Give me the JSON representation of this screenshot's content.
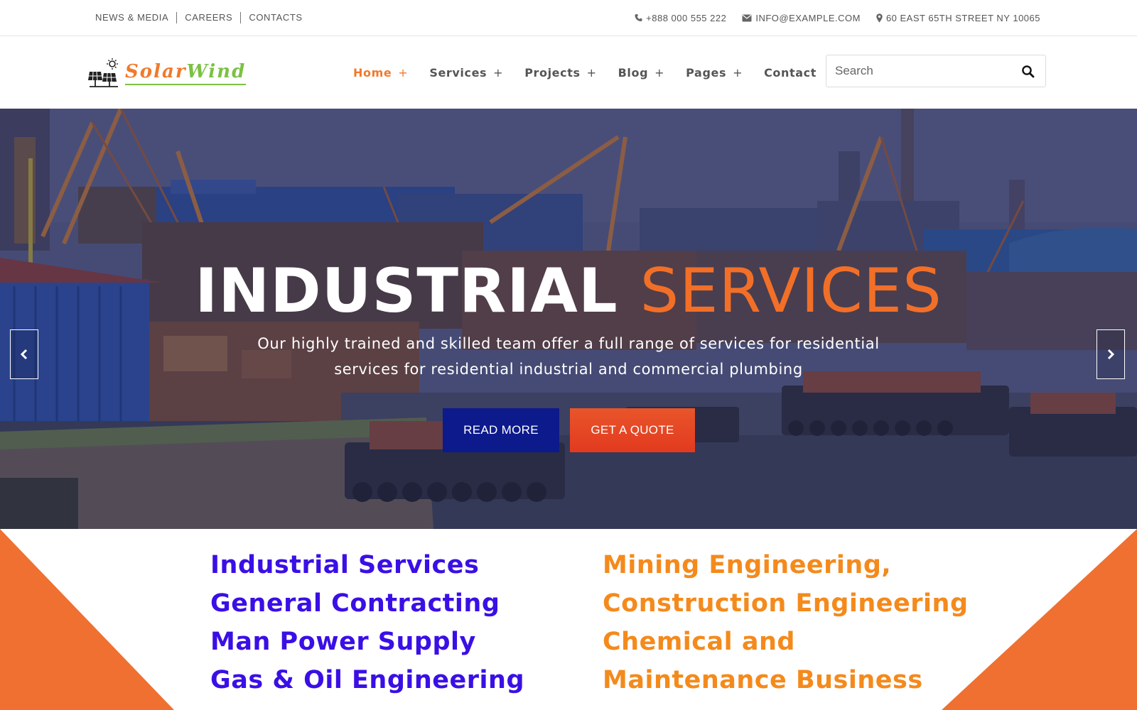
{
  "topbar": {
    "links": [
      "NEWS & MEDIA",
      "CAREERS",
      "CONTACTS"
    ],
    "phone": "+888 000 555 222",
    "email": "INFO@EXAMPLE.COM",
    "address": "60 EAST 65TH STREET NY 10065"
  },
  "logo": {
    "part1": "Solar",
    "part2": "Wind"
  },
  "nav": {
    "items": [
      {
        "label": "Home",
        "plus": "+"
      },
      {
        "label": "Services",
        "plus": "+"
      },
      {
        "label": "Projects",
        "plus": "+"
      },
      {
        "label": "Blog",
        "plus": "+"
      },
      {
        "label": "Pages",
        "plus": "+"
      },
      {
        "label": "Contact"
      }
    ],
    "active_index": 0
  },
  "search": {
    "placeholder": "Search"
  },
  "hero": {
    "title_white": "INDUSTRIAL",
    "title_orange": "SERVICES",
    "description": "Our highly trained and skilled team offer a full range of services for residential services for residential industrial and commercial plumbing",
    "read_more": "READ MORE",
    "get_quote": "GET A QUOTE"
  },
  "services_left": [
    "Industrial Services",
    "General Contracting",
    "Man Power Supply",
    "Gas & Oil Engineering"
  ],
  "services_right": [
    "Mining Engineering,",
    "Construction Engineering",
    "Chemical and",
    "Maintenance Business"
  ],
  "colors": {
    "accent_orange": "#f07a2c",
    "logo_green": "#7cc144",
    "read_more_bg": "#0c1a8c",
    "quote_bg": "#e23a1f",
    "services_left_color": "#3a0fe6",
    "services_right_color": "#f48a1c",
    "triangle_color": "#ef7030"
  },
  "icons": {
    "phone": "phone-icon",
    "email": "envelope-icon",
    "address": "map-marker-icon",
    "search": "search-icon",
    "prev": "chevron-left-icon",
    "next": "chevron-right-icon",
    "logo": "solar-panel-icon"
  }
}
